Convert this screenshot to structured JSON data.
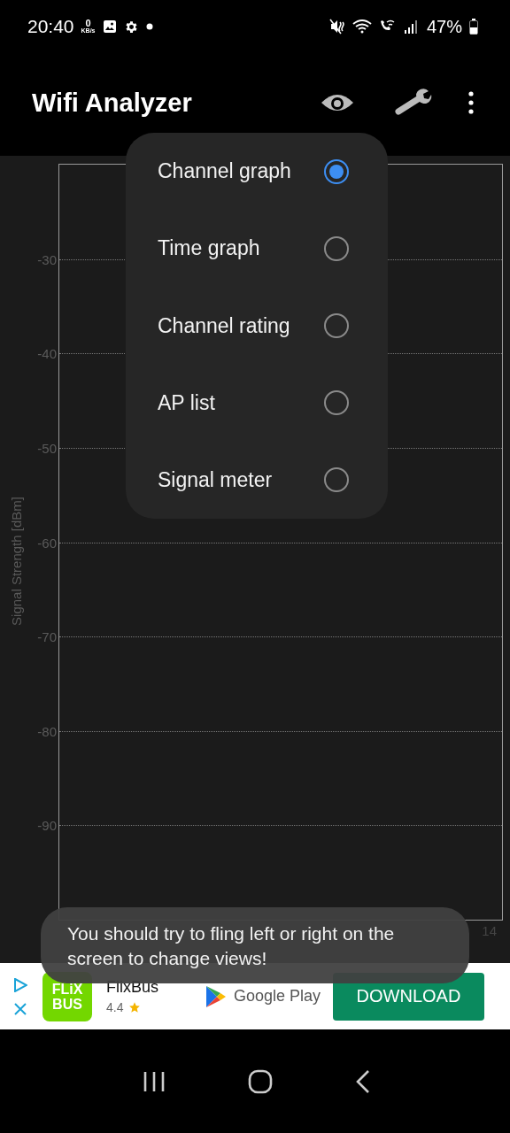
{
  "status_bar": {
    "time": "20:40",
    "net_speed_value": "0",
    "net_speed_unit": "KB/s",
    "battery": "47%"
  },
  "app_bar": {
    "title": "Wifi Analyzer"
  },
  "chart": {
    "ylabel": "Signal Strength [dBm]",
    "yticks": [
      "-30",
      "-40",
      "-50",
      "-60",
      "-70",
      "-80",
      "-90"
    ],
    "xticks": [
      "14"
    ]
  },
  "view_menu": {
    "items": [
      {
        "label": "Channel graph",
        "selected": true
      },
      {
        "label": "Time graph",
        "selected": false
      },
      {
        "label": "Channel rating",
        "selected": false
      },
      {
        "label": "AP list",
        "selected": false
      },
      {
        "label": "Signal meter",
        "selected": false
      }
    ]
  },
  "toast": {
    "text": "You should try to fling left or right on the screen to change views!"
  },
  "ad": {
    "logo_line_1": "FLiX",
    "logo_line_2": "BUS",
    "name": "FlixBus",
    "rating": "4.4",
    "store": "Google Play",
    "button": "DOWNLOAD"
  }
}
